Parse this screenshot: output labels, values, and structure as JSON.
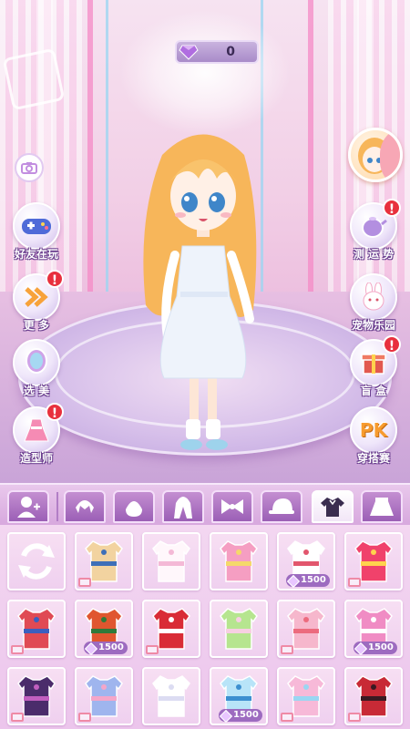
{
  "currency": {
    "value": "0",
    "icon": "purple-gem-icon"
  },
  "left_buttons": [
    {
      "label": "好友在玩",
      "icon": "gamepad-icon",
      "alert": false
    },
    {
      "label": "更 多",
      "icon": "double-chevron-icon",
      "alert": true
    },
    {
      "label": "选 美",
      "icon": "mirror-icon",
      "alert": false
    },
    {
      "label": "造型师",
      "icon": "dress-icon",
      "alert": true
    }
  ],
  "right_buttons": [
    {
      "label": "测 运 势",
      "icon": "teapot-icon",
      "alert": true
    },
    {
      "label": "宠物乐园",
      "icon": "bunny-icon",
      "alert": false
    },
    {
      "label": "盲 盒",
      "icon": "gift-box-icon",
      "alert": true
    },
    {
      "label": "穿搭赛",
      "icon": "pk-icon",
      "badge_text": "PK",
      "alert": false
    }
  ],
  "alert_mark": "!",
  "tabs": [
    {
      "icon": "person-add-icon"
    },
    {
      "icon": "short-hair-icon"
    },
    {
      "icon": "hair-back-icon"
    },
    {
      "icon": "long-hair-icon"
    },
    {
      "icon": "bow-icon"
    },
    {
      "icon": "cap-icon"
    },
    {
      "icon": "shirt-icon",
      "active": true
    },
    {
      "icon": "skirt-icon"
    }
  ],
  "items": [
    {
      "icon": "reset-icon"
    },
    {
      "icon": "corset-top-icon",
      "video": true
    },
    {
      "icon": "tutu-dress-icon"
    },
    {
      "icon": "pink-yellow-top-icon"
    },
    {
      "icon": "sailor-top-icon",
      "price": "1500"
    },
    {
      "icon": "cat-top-icon",
      "video": true
    },
    {
      "icon": "striped-jacket-icon",
      "video": true
    },
    {
      "icon": "pumpkin-top-icon",
      "price": "1500"
    },
    {
      "icon": "red-dot-top-icon",
      "video": true
    },
    {
      "icon": "green-top-icon"
    },
    {
      "icon": "kimono-top-icon",
      "video": true
    },
    {
      "icon": "pink-check-top-icon",
      "price": "1500"
    },
    {
      "icon": "purple-corset-icon",
      "video": true
    },
    {
      "icon": "plaid-bralette-icon",
      "video": true
    },
    {
      "icon": "white-lace-top-icon"
    },
    {
      "icon": "blue-bow-top-icon",
      "price": "1500"
    },
    {
      "icon": "pink-cami-icon",
      "video": true
    },
    {
      "icon": "red-gothic-top-icon",
      "video": true
    }
  ]
}
